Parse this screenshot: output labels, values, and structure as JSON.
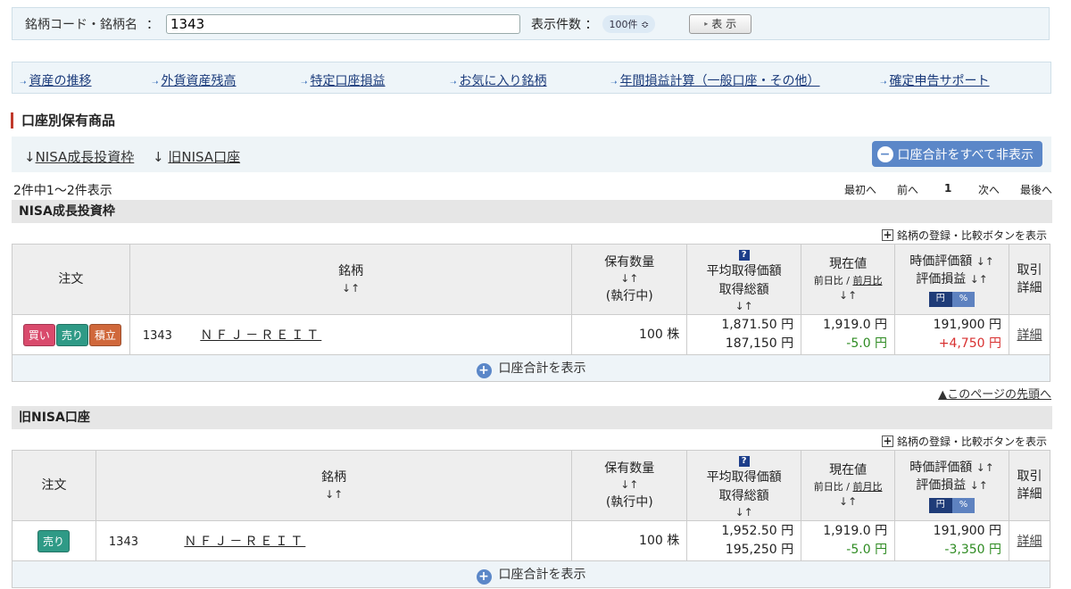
{
  "search": {
    "label": "銘柄コード・銘柄名",
    "colon": "：",
    "value": "1343",
    "count_label": "表示件数 ：",
    "count_value": "100件 ≎",
    "show_button": "表 示"
  },
  "nav": {
    "links": [
      "資産の推移",
      "外貨資産残高",
      "特定口座損益",
      "お気に入り銘柄",
      "年間損益計算（一般口座・その他）",
      "確定申告サポート"
    ]
  },
  "section_title": "口座別保有商品",
  "anchors": {
    "arrow": "↓",
    "nisa_growth": "NISA成長投資枠",
    "old_nisa": "旧NISA口座",
    "hide_all": "口座合計をすべて非表示"
  },
  "result_count": "2件中1～2件表示",
  "pager": {
    "first": "最初へ",
    "prev": "前へ",
    "current": "1",
    "next": "次へ",
    "last": "最後へ"
  },
  "compare_label": "銘柄の登録・比較ボタンを表示",
  "headers": {
    "order": "注文",
    "name": "銘柄",
    "qty": "保有数量",
    "qty_sub": "(執行中)",
    "avg": "平均取得価額",
    "total_cost": "取得総額",
    "price": "現在値",
    "day": "前日比",
    "month": "前月比",
    "slash": "/",
    "mv": "時価評価額",
    "pl": "評価損益",
    "yen": "円",
    "pct": "%",
    "trade1": "取引",
    "trade2": "詳細",
    "sort": "↓↑",
    "help": "?"
  },
  "groups": [
    {
      "title": "NISA成長投資枠",
      "row": {
        "buttons": [
          "買い",
          "売り",
          "積立"
        ],
        "code": "1343",
        "name": "ＮＦＪ－ＲＥＩＴ",
        "qty": "100 株",
        "avg": "1,871.50 円",
        "total": "187,150 円",
        "price": "1,919.0 円",
        "change": "-5.0 円",
        "mv": "191,900 円",
        "pl": "+4,750 円",
        "detail": "詳細"
      },
      "sum_label": "口座合計を表示"
    },
    {
      "title": "旧NISA口座",
      "row": {
        "buttons": [
          "売り"
        ],
        "code": "1343",
        "name": "ＮＦＪ－ＲＥＩＴ",
        "qty": "100 株",
        "avg": "1,952.50 円",
        "total": "195,250 円",
        "price": "1,919.0 円",
        "change": "-5.0 円",
        "mv": "191,900 円",
        "pl": "-3,350 円",
        "detail": "詳細"
      },
      "sum_label": "口座合計を表示"
    }
  ],
  "page_top": "▲このページの先頭へ",
  "colors": {
    "buy": "#d94a6c",
    "sell": "#2f9a86",
    "tsumi": "#d0683b",
    "accent": "#5b87c8",
    "gain": "#d83030",
    "loss": "#2e8b22"
  }
}
